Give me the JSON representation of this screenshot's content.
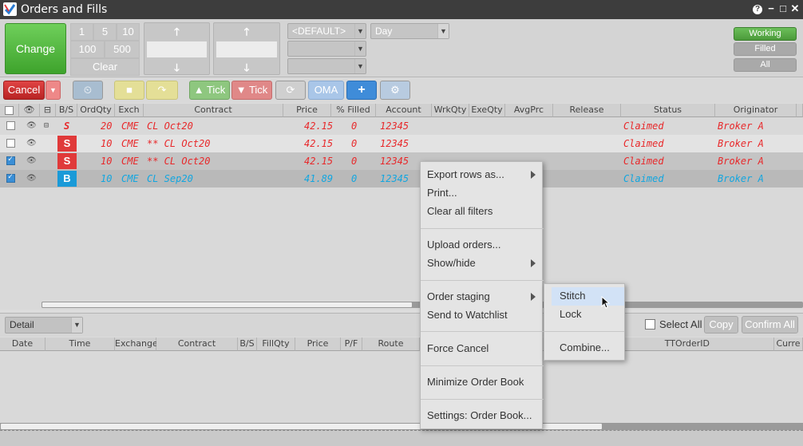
{
  "window": {
    "title": "Orders and Fills",
    "help": "?",
    "minimize": "−",
    "maximize": "□",
    "close": "✕"
  },
  "toolbar": {
    "change": "Change",
    "qty_buttons": [
      "1",
      "5",
      "10",
      "100",
      "500"
    ],
    "clear": "Clear",
    "up_arrow": "🡑",
    "down_arrow": "🡓",
    "default_dd": "<DEFAULT>",
    "tif_dd": "Day",
    "working": "Working",
    "filled": "Filled",
    "all": "All"
  },
  "toolbar2": {
    "cancel": "Cancel",
    "tick_up": "Tick",
    "tick_down": "Tick",
    "oma": "OMA",
    "plus": "+",
    "undo": "⟳",
    "redo": "↷"
  },
  "grid": {
    "headers": [
      "B/S",
      "OrdQty",
      "Exch",
      "Contract",
      "Price",
      "% Filled",
      "Account",
      "WrkQty",
      "ExeQty",
      "AvgPrc",
      "Release",
      "Status",
      "Originator"
    ],
    "rows": [
      {
        "bs": "S",
        "qty": "20",
        "exch": "CME",
        "contract": "CL Oct20",
        "price": "42.15",
        "filled": "0",
        "account": "12345",
        "status": "Claimed",
        "orig": "Broker A",
        "checked": false,
        "parent": true
      },
      {
        "bs": "S",
        "qty": "10",
        "exch": "CME",
        "contract": "** CL Oct20",
        "price": "42.15",
        "filled": "0",
        "account": "12345",
        "status": "Claimed",
        "orig": "Broker A",
        "checked": false,
        "parent": false
      },
      {
        "bs": "S",
        "qty": "10",
        "exch": "CME",
        "contract": "** CL Oct20",
        "price": "42.15",
        "filled": "0",
        "account": "12345",
        "status": "Claimed",
        "orig": "Broker A",
        "checked": true,
        "parent": false
      },
      {
        "bs": "B",
        "qty": "10",
        "exch": "CME",
        "contract": "CL Sep20",
        "price": "41.89",
        "filled": "0",
        "account": "12345",
        "status": "Claimed",
        "orig": "Broker A",
        "checked": true,
        "parent": false
      }
    ]
  },
  "context_menu": {
    "items": [
      "Export rows as...",
      "Print...",
      "Clear all filters",
      "Upload orders...",
      "Show/hide",
      "Order staging",
      "Send to Watchlist",
      "Force Cancel",
      "Minimize Order Book",
      "Settings: Order Book..."
    ],
    "submenu": [
      "Stitch",
      "Lock",
      "Combine..."
    ]
  },
  "fills": {
    "view_dd": "Detail",
    "select_all": "Select All",
    "copy": "Copy",
    "confirm_all": "Confirm All",
    "headers": [
      "Date",
      "Time",
      "Exchange",
      "Contract",
      "B/S",
      "FillQty",
      "Price",
      "P/F",
      "Route",
      "TTOrderID",
      "Curre"
    ]
  },
  "colors": {
    "sell": "#e03a3a",
    "buy": "#1a9ad8",
    "sell_text": "#e8282a",
    "buy_text": "#12a6e0"
  }
}
